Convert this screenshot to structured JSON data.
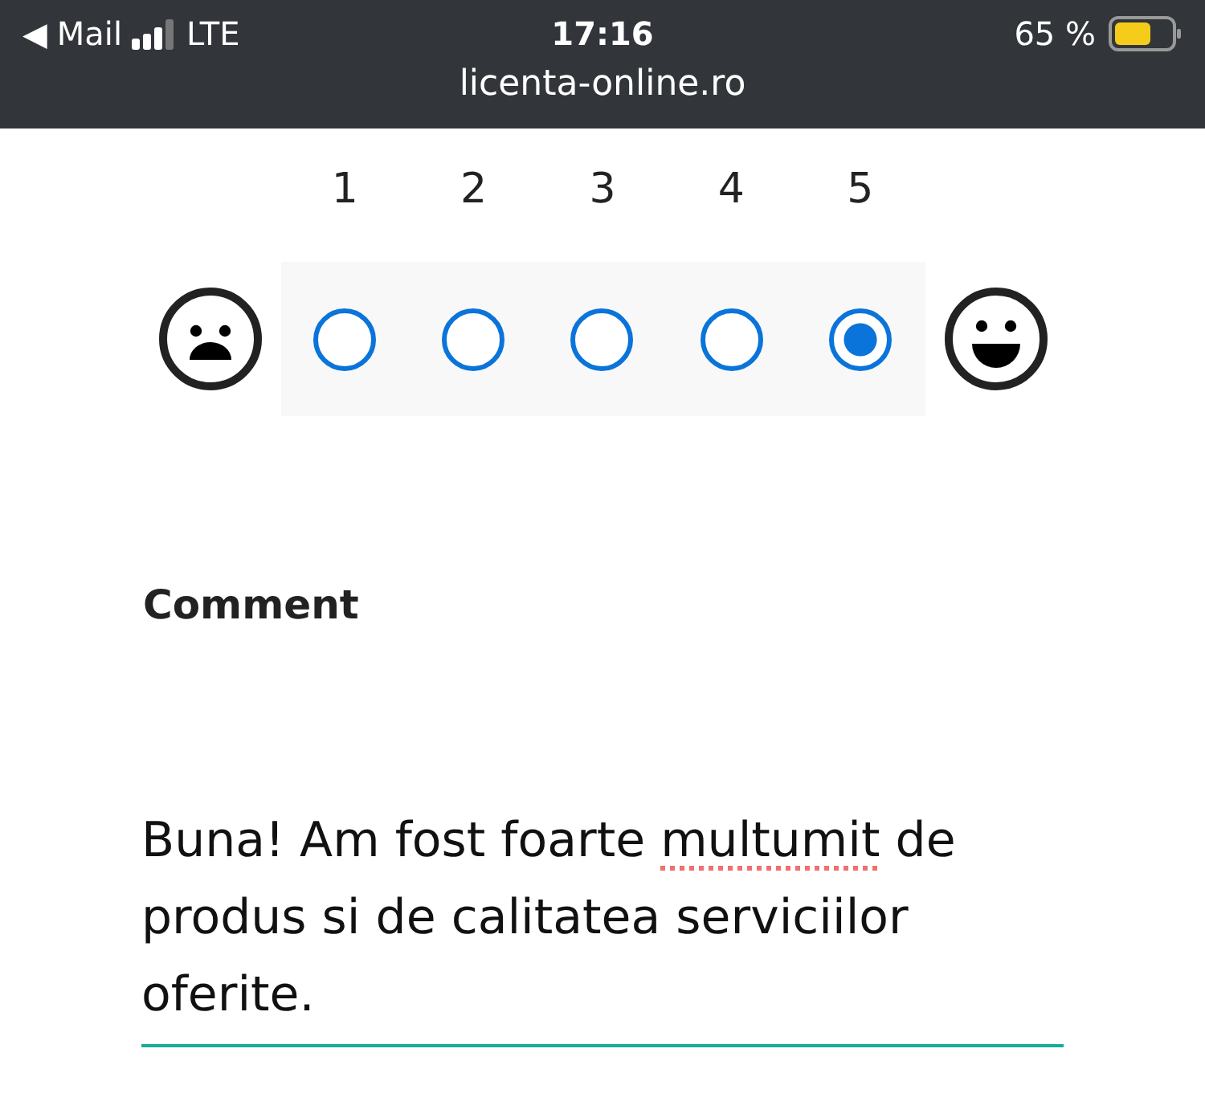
{
  "status_bar": {
    "back_arrow": "◀",
    "back_app": "Mail",
    "network": "LTE",
    "time": "17:16",
    "battery": "65 %"
  },
  "address_bar": {
    "url": "licenta-online.ro"
  },
  "rating": {
    "options": [
      {
        "label": "1",
        "selected": false
      },
      {
        "label": "2",
        "selected": false
      },
      {
        "label": "3",
        "selected": false
      },
      {
        "label": "4",
        "selected": false
      },
      {
        "label": "5",
        "selected": true
      }
    ]
  },
  "comment": {
    "label": "Comment",
    "value": [
      {
        "text": "Buna! Am fost foarte ",
        "misspelled": false
      },
      {
        "text": "multumit",
        "misspelled": true
      },
      {
        "text": " de produs si de calitatea serviciilor oferite.",
        "misspelled": false
      }
    ]
  }
}
